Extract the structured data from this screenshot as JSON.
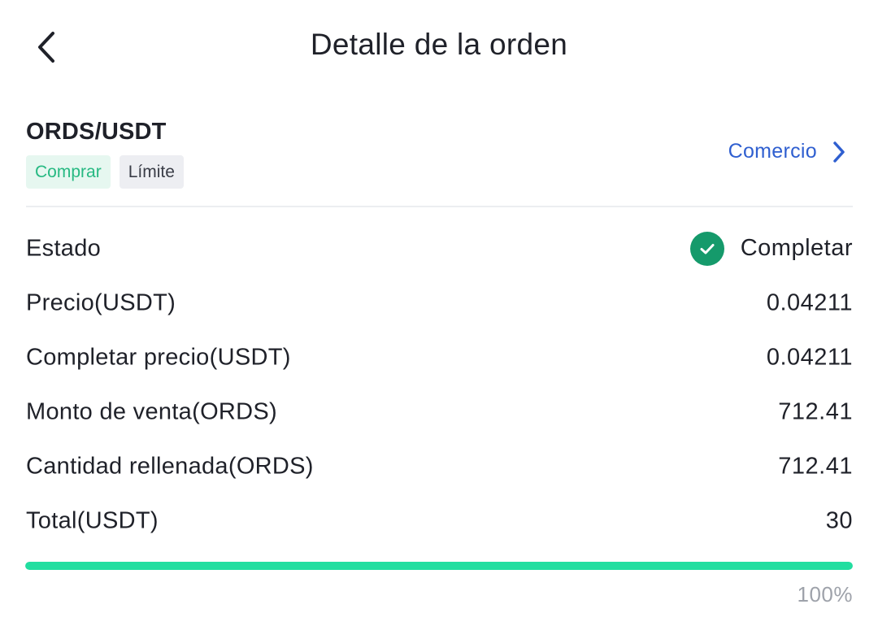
{
  "header": {
    "title": "Detalle de la orden",
    "back_icon": "chevron-left-icon"
  },
  "order": {
    "pair": "ORDS/USDT",
    "side_tag": "Comprar",
    "type_tag": "Límite",
    "trade_link": "Comercio",
    "trade_link_icon": "chevron-right-icon"
  },
  "details": {
    "status_label": "Estado",
    "status_value": "Completar",
    "status_icon": "check-circle-icon",
    "price_label": "Precio(USDT)",
    "price_value": "0.04211",
    "filled_price_label": "Completar precio(USDT)",
    "filled_price_value": "0.04211",
    "amount_label": "Monto de venta(ORDS)",
    "amount_value": "712.41",
    "filled_qty_label": "Cantidad rellenada(ORDS)",
    "filled_qty_value": "712.41",
    "total_label": "Total(USDT)",
    "total_value": "30"
  },
  "progress": {
    "percent": 100,
    "label": "100%"
  },
  "colors": {
    "accent_green": "#22dea0",
    "status_green": "#159a6b",
    "buy_tag_text": "#26b982",
    "link_blue": "#2f5fd0"
  }
}
